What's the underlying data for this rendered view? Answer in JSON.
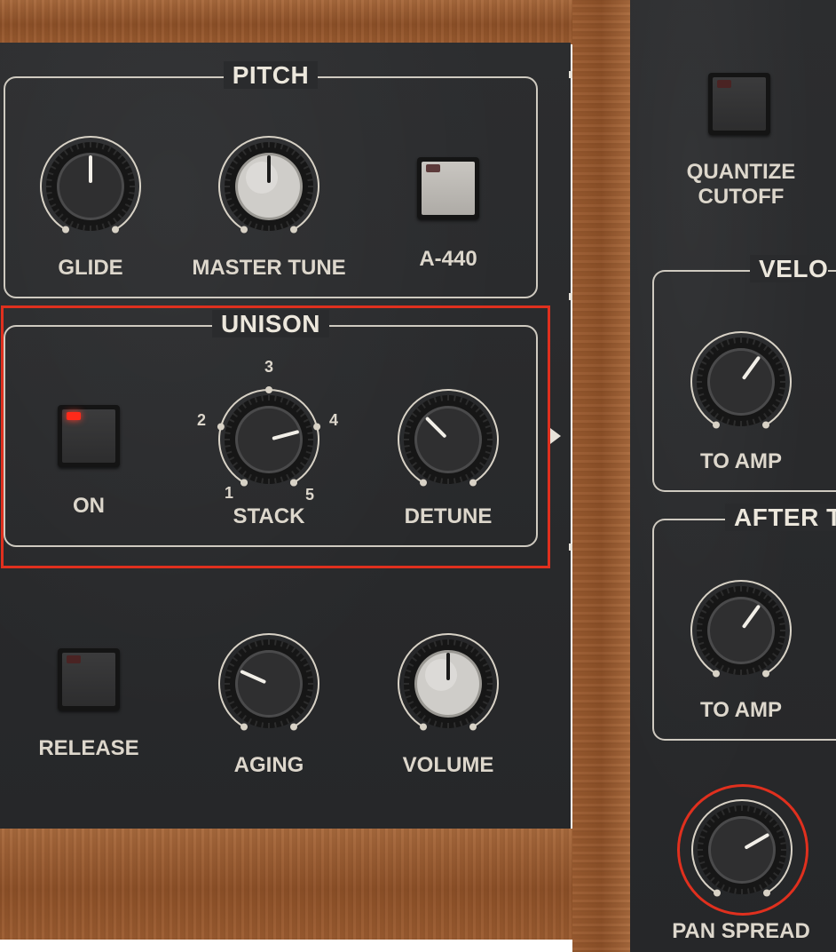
{
  "pitch": {
    "title": "PITCH",
    "glide_label": "GLIDE",
    "master_tune_label": "MASTER TUNE",
    "a440_label": "A-440",
    "glide_value": 0.5,
    "master_tune_value": 0.5
  },
  "unison": {
    "title": "UNISON",
    "on_label": "ON",
    "on_active": true,
    "stack_label": "STACK",
    "stack_positions": [
      "1",
      "2",
      "3",
      "4",
      "5"
    ],
    "stack_value": "4",
    "detune_label": "DETUNE",
    "detune_value": 0.35
  },
  "bottom": {
    "release_label": "RELEASE",
    "aging_label": "AGING",
    "volume_label": "VOLUME",
    "aging_value": 0.28,
    "volume_value": 0.5
  },
  "right_panel": {
    "quantize_label_line1": "QUANTIZE",
    "quantize_label_line2": "CUTOFF",
    "velocity_title": "VELO",
    "velocity_to_amp_label": "TO AMP",
    "velocity_to_amp_value": 0.62,
    "aftertouch_title": "AFTER T",
    "aftertouch_to_amp_label": "TO AMP",
    "aftertouch_to_amp_value": 0.62,
    "pan_spread_label": "PAN SPREAD",
    "pan_spread_value": 0.7
  },
  "colors": {
    "panel": "#2a2b2d",
    "wood": "#8e5128",
    "label": "#ddd7cc",
    "led_on": "#ff2a1a",
    "highlight": "#e0301e"
  }
}
